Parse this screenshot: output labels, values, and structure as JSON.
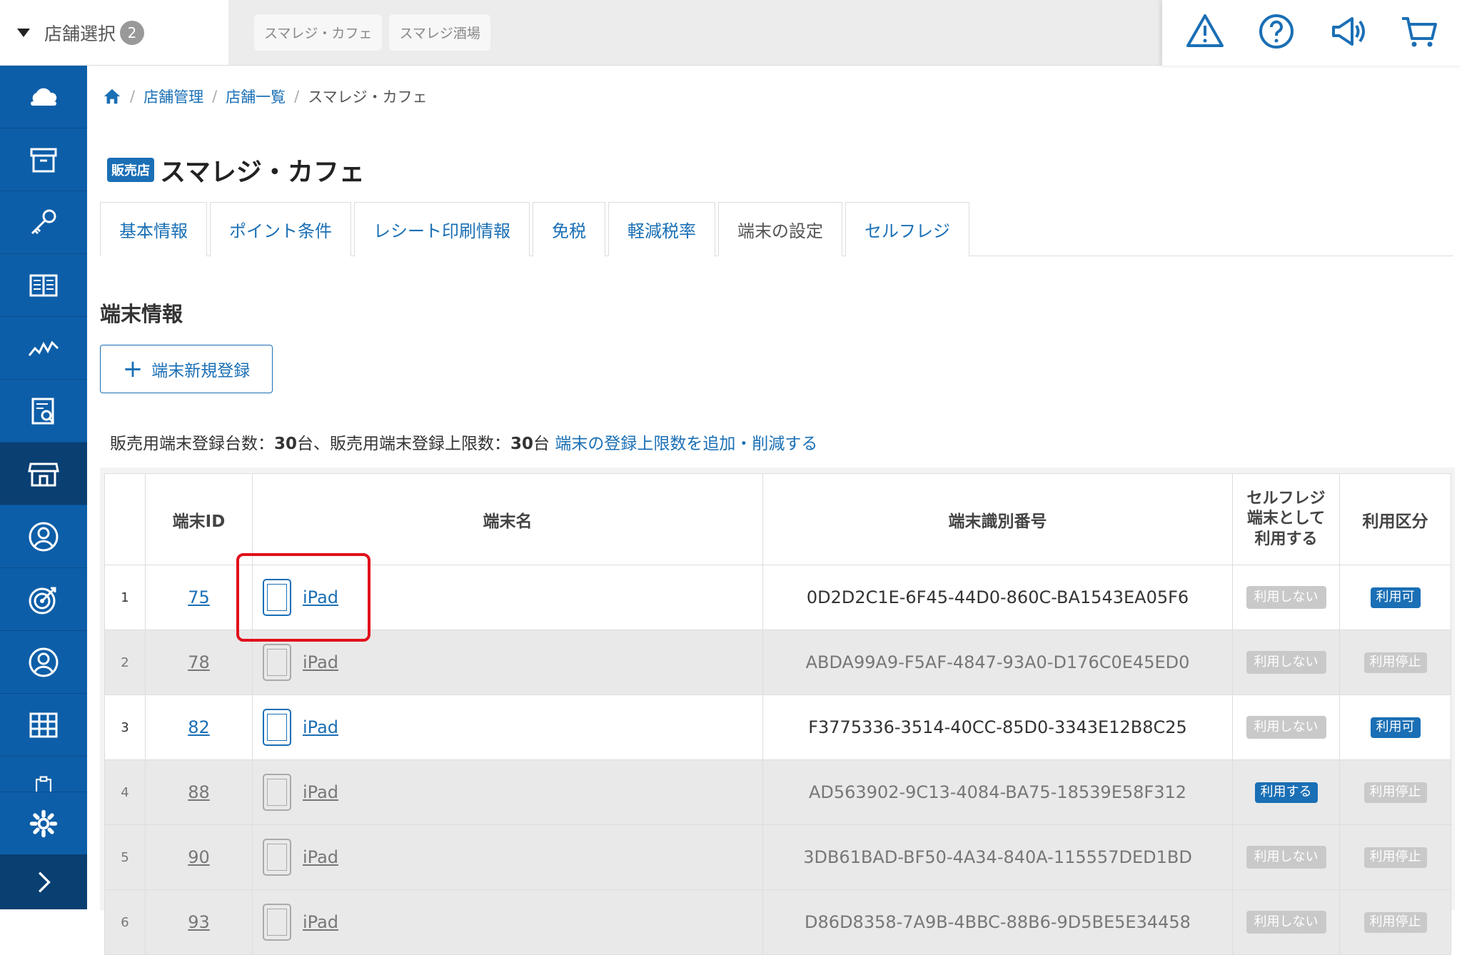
{
  "topbar": {
    "store_select_label": "店舗選択",
    "store_count": "2",
    "stores": [
      "スマレジ・カフェ",
      "スマレジ酒場"
    ],
    "icons": [
      "warning-icon",
      "help-icon",
      "announcement-icon",
      "cart-icon"
    ]
  },
  "sidebar": {
    "items": [
      "cloud-icon",
      "box-icon",
      "key-icon",
      "book-icon",
      "chart-icon",
      "report-icon",
      "store-icon",
      "customer-icon",
      "target-icon",
      "user-icon",
      "grid-icon",
      "clipboard-icon"
    ],
    "active": "store-icon",
    "bottom": [
      "gear-icon",
      "chevron-right-icon"
    ]
  },
  "breadcrumb": {
    "home": "home-icon",
    "items": [
      "店舗管理",
      "店舗一覧"
    ],
    "current": "スマレジ・カフェ"
  },
  "page": {
    "badge": "販売店",
    "title": "スマレジ・カフェ"
  },
  "tabs": [
    {
      "label": "基本情報"
    },
    {
      "label": "ポイント条件"
    },
    {
      "label": "レシート印刷情報"
    },
    {
      "label": "免税"
    },
    {
      "label": "軽減税率"
    },
    {
      "label": "端末の設定",
      "active": true
    },
    {
      "label": "セルフレジ"
    }
  ],
  "section": {
    "title": "端末情報",
    "add_button": "端末新規登録"
  },
  "summary": {
    "prefix": "販売用端末登録台数：",
    "count": "30",
    "mid": "台、販売用端末登録上限数：",
    "limit": "30",
    "suffix": "台",
    "link": "端末の登録上限数を追加・削減する"
  },
  "table": {
    "headers": [
      "",
      "端末ID",
      "端末名",
      "端末識別番号",
      "セルフレジ\n端末として\n利用する",
      "利用区分"
    ],
    "rows": [
      {
        "no": "1",
        "id": "75",
        "name": "iPad",
        "ident": "0D2D2C1E-6F45-44D0-860C-BA1543EA05F6",
        "self": "利用しない",
        "status": "利用可",
        "enabled": true
      },
      {
        "no": "2",
        "id": "78",
        "name": "iPad",
        "ident": "ABDA99A9-F5AF-4847-93A0-D176C0E45ED0",
        "self": "利用しない",
        "status": "利用停止",
        "enabled": false
      },
      {
        "no": "3",
        "id": "82",
        "name": "iPad",
        "ident": "F3775336-3514-40CC-85D0-3343E12B8C25",
        "self": "利用しない",
        "status": "利用可",
        "enabled": true
      },
      {
        "no": "4",
        "id": "88",
        "name": "iPad",
        "ident": "AD563902-9C13-4084-BA75-18539E58F312",
        "self": "利用する",
        "status": "利用停止",
        "enabled": false
      },
      {
        "no": "5",
        "id": "90",
        "name": "iPad",
        "ident": "3DB61BAD-BF50-4A34-840A-115557DED1BD",
        "self": "利用しない",
        "status": "利用停止",
        "enabled": false
      },
      {
        "no": "6",
        "id": "93",
        "name": "iPad",
        "ident": "D86D8358-7A9B-4BBC-88B6-9D5BE5E34458",
        "self": "利用しない",
        "status": "利用停止",
        "enabled": false
      }
    ]
  },
  "colors": {
    "primary": "#1a6fb5",
    "sidebar": "#0d5ea8",
    "highlight": "#e0111a"
  }
}
